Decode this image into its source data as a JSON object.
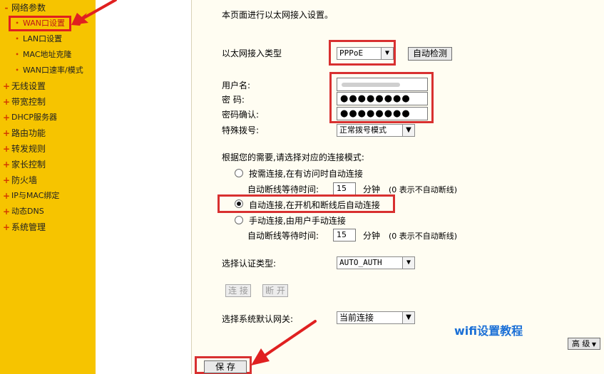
{
  "sidebar": {
    "items": [
      {
        "label": "网络参数",
        "marker": "-"
      },
      {
        "label": "WAN口设置",
        "marker": "•"
      },
      {
        "label": "LAN口设置",
        "marker": "•"
      },
      {
        "label": "MAC地址克隆",
        "marker": "•"
      },
      {
        "label": "WAN口速率/模式",
        "marker": "•"
      },
      {
        "label": "无线设置",
        "marker": "+"
      },
      {
        "label": "带宽控制",
        "marker": "+"
      },
      {
        "label": "DHCP服务器",
        "marker": "+"
      },
      {
        "label": "路由功能",
        "marker": "+"
      },
      {
        "label": "转发规则",
        "marker": "+"
      },
      {
        "label": "家长控制",
        "marker": "+"
      },
      {
        "label": "防火墙",
        "marker": "+"
      },
      {
        "label": "IP与MAC绑定",
        "marker": "+"
      },
      {
        "label": "动态DNS",
        "marker": "+"
      },
      {
        "label": "系统管理",
        "marker": "+"
      }
    ]
  },
  "page": {
    "intro": "本页面进行以太网接入设置。",
    "conn_type_label": "以太网接入类型",
    "conn_type_value": "PPPoE",
    "auto_detect_label": "自动检测",
    "username_label": "用户名:",
    "password_label": "密  码:",
    "password_confirm_label": "密码确认:",
    "password_value": "●●●●●●●●",
    "password_confirm_value": "●●●●●●●●",
    "special_dial_label": "特殊拨号:",
    "special_dial_value": "正常拨号模式",
    "mode_prompt": "根据您的需要,请选择对应的连接模式:",
    "mode_on_demand": "按需连接,在有访问时自动连接",
    "idle_label": "自动断线等待时间:",
    "idle_value_1": "15",
    "idle_unit": "分钟",
    "idle_hint": "(0 表示不自动断线)",
    "mode_auto": "自动连接,在开机和断线后自动连接",
    "mode_manual": "手动连接,由用户手动连接",
    "idle_value_2": "15",
    "auth_label": "选择认证类型:",
    "auth_value": "AUTO_AUTH",
    "connect_label": "连 接",
    "disconnect_label": "断 开",
    "gateway_label": "选择系统默认网关:",
    "gateway_value": "当前连接",
    "watermark": "wifi设置教程",
    "advanced_label": "高 级",
    "save_label": "保 存"
  },
  "colors": {
    "sidebar": "#f6c400",
    "highlight": "#d83030",
    "watermark": "#1a6fd6"
  }
}
